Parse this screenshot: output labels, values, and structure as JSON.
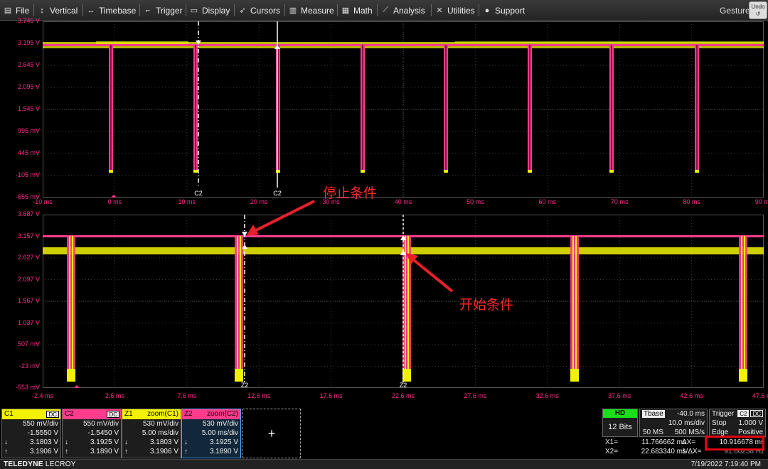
{
  "menu": [
    {
      "label": "File",
      "icon": "file-icon"
    },
    {
      "label": "Vertical",
      "icon": "vertical-arrows-icon"
    },
    {
      "label": "Timebase",
      "icon": "horizontal-arrows-icon"
    },
    {
      "label": "Trigger",
      "icon": "trigger-icon"
    },
    {
      "label": "Display",
      "icon": "display-icon"
    },
    {
      "label": "Cursors",
      "icon": "cursor-icon"
    },
    {
      "label": "Measure",
      "icon": "measure-icon"
    },
    {
      "label": "Math",
      "icon": "math-icon"
    },
    {
      "label": "Analysis",
      "icon": "analysis-icon"
    },
    {
      "label": "Utilities",
      "icon": "wrench-icon"
    },
    {
      "label": "Support",
      "icon": "support-icon"
    }
  ],
  "gesture_label": "Gesture",
  "undo_label": "Undo",
  "upper_graph": {
    "y_labels": [
      "3.745 V",
      "3.195 V",
      "2.645 V",
      "2.095 V",
      "1.545 V",
      "995 mV",
      "445 mV",
      "-105 mV",
      "-655 mV"
    ],
    "x_labels": [
      "-10 ms",
      "0 ms",
      "10 ms",
      "20 ms",
      "30 ms",
      "40 ms",
      "50 ms",
      "60 ms",
      "70 ms",
      "80 ms",
      "90 ms"
    ],
    "cursor_labels": [
      "C2",
      "C2"
    ],
    "trace_tag": "C2"
  },
  "lower_graph": {
    "y_labels": [
      "3.687 V",
      "3.157 V",
      "2.627 V",
      "2.097 V",
      "1.567 V",
      "1.037 V",
      "507 mV",
      "-23 mV",
      "-553 mV"
    ],
    "x_labels": [
      "-2.4 ms",
      "2.6 ms",
      "7.6 ms",
      "12.6 ms",
      "17.6 ms",
      "22.6 ms",
      "27.6 ms",
      "32.6 ms",
      "37.6 ms",
      "42.6 ms",
      "47.6 ms"
    ],
    "cursor_labels": [
      "Z2",
      "Z2"
    ],
    "trace_tags": [
      "Z2",
      "Z1"
    ]
  },
  "annotations": {
    "stop_condition": "停止条件",
    "start_condition": "开始条件"
  },
  "channels": [
    {
      "name": "C1",
      "tag": "DC",
      "color": "#f2f200",
      "lines": [
        "550 mV/div",
        "-1.5550 V",
        "3.1803 V",
        "3.1906 V"
      ]
    },
    {
      "name": "C2",
      "tag": "DC",
      "color": "#ff3b8c",
      "lines": [
        "550 mV/div",
        "-1.5450 V",
        "3.1925 V",
        "3.1890 V"
      ]
    },
    {
      "name": "Z1",
      "tag": "zoom(C1)",
      "color": "#f2f200",
      "lines": [
        "530 mV/div",
        "5.00 ms/div",
        "3.1803 V",
        "3.1906 V"
      ]
    },
    {
      "name": "Z2",
      "tag": "zoom(C2)",
      "color": "#ff3b8c",
      "lines": [
        "530 mV/div",
        "5.00 ms/div",
        "3.1925 V",
        "3.1890 V"
      ]
    }
  ],
  "add_label": "+",
  "acquisition": {
    "mode": "HD",
    "bits": "12 Bits"
  },
  "timebase": {
    "title": "Tbase",
    "delay": "-40.0 ms",
    "scale": "10.0 ms/div",
    "samples": "50 MS",
    "rate": "500 MS/s"
  },
  "trigger": {
    "title": "Trigger",
    "source": "C2",
    "coupling": "DC",
    "mode": "Stop",
    "level": "1.000 V",
    "type": "Edge",
    "slope": "Positive"
  },
  "cursors": {
    "x1_label": "X1=",
    "x1": "11.766662 ms",
    "x2_label": "X2=",
    "x2": "22.683340 ms",
    "dx_label": "ΔX=",
    "dx": "10.916678 ms",
    "inv_label": "1/ΔX=",
    "inv": "91.60258 Hz"
  },
  "brand": {
    "name": "TELEDYNE",
    "sub": "LECROY"
  },
  "datetime": "7/19/2022 7:19:40 PM",
  "colors": {
    "c1": "#f2f200",
    "c2": "#ff3b8c",
    "axis": "#ff2e8c",
    "annotation": "#ff2a2a"
  }
}
